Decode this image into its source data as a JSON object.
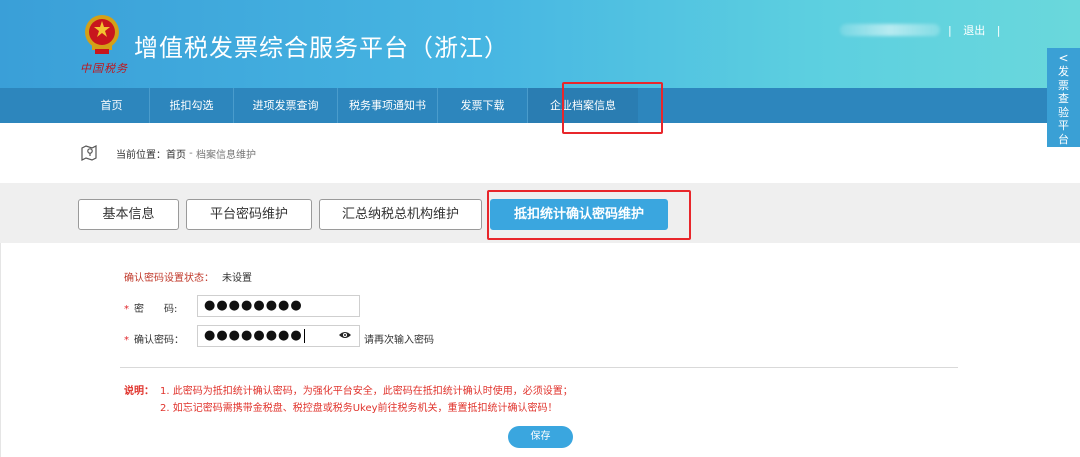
{
  "header": {
    "logo_script": "中国税务",
    "title": "增值税发票综合服务平台（浙江）",
    "separator_left": "|",
    "logout": "退出",
    "separator_right": "|"
  },
  "nav": {
    "items": [
      {
        "label": "首页"
      },
      {
        "label": "抵扣勾选"
      },
      {
        "label": "进项发票查询"
      },
      {
        "label": "税务事项通知书"
      },
      {
        "label": "发票下载"
      },
      {
        "label": "企业档案信息"
      }
    ]
  },
  "side_tab": {
    "arrow": "<",
    "label": "发票查验平台"
  },
  "breadcrumb": {
    "prefix": "当前位置：首页",
    "sep": " - ",
    "current": "档案信息维护"
  },
  "tabs": [
    {
      "label": "基本信息"
    },
    {
      "label": "平台密码维护"
    },
    {
      "label": "汇总纳税总机构维护"
    },
    {
      "label": "抵扣统计确认密码维护"
    }
  ],
  "form": {
    "status_label": "确认密码设置状态：",
    "status_value": "未设置",
    "password_label": "密　　码:",
    "password_value": "●●●●●●●●",
    "confirm_label": "确认密码：",
    "confirm_value": "●●●●●●●●",
    "confirm_hint": "请再次输入密码",
    "required_mark": "*"
  },
  "notes": {
    "prefix": "说明：",
    "line1": "1. 此密码为抵扣统计确认密码，为强化平台安全，此密码在抵扣统计确认时使用，必须设置；",
    "line2": "2. 如忘记密码需携带金税盘、税控盘或税务Ukey前往税务机关，重置抵扣统计确认密码！"
  },
  "save_label": "保存",
  "colors": {
    "header_start": "#3a9fd8",
    "header_end": "#6ad8dc",
    "nav_bg": "#2d86bd",
    "accent": "#3aa6df",
    "highlight_box": "#e8262b",
    "note_text": "#e0332c"
  }
}
